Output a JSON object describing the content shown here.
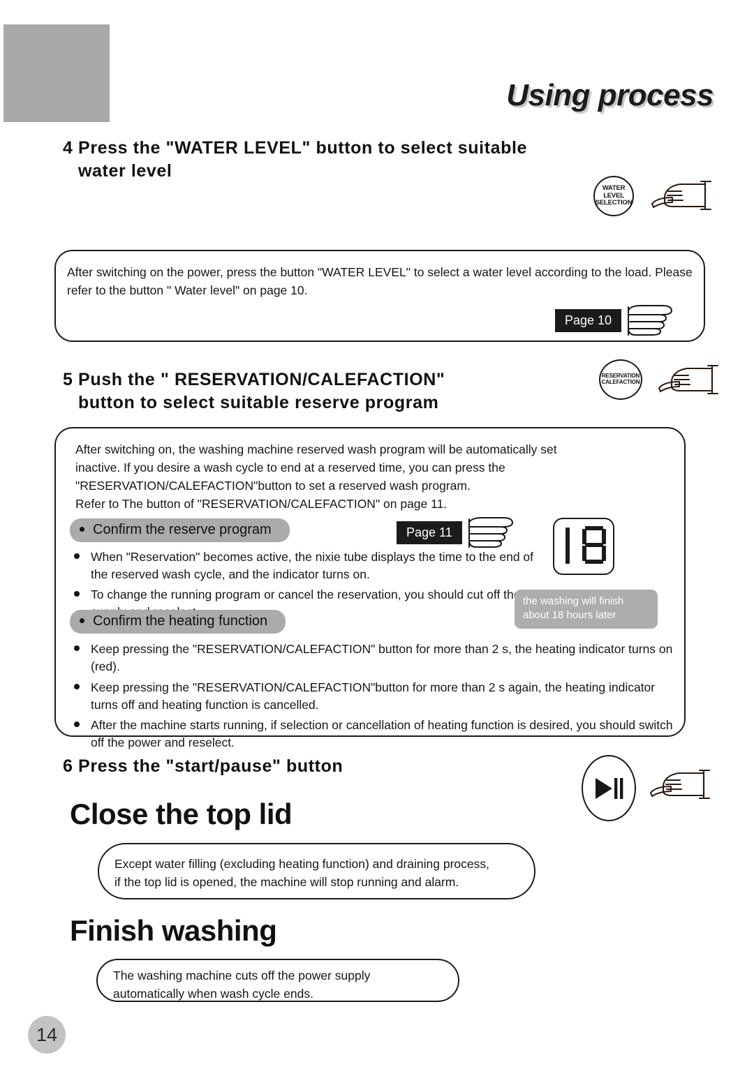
{
  "header": {
    "title": "Using process",
    "page_number": "14"
  },
  "steps": [
    {
      "number": "4",
      "line1": "4 Press the \"WATER LEVEL\" button to select suitable",
      "line2": "water level",
      "button": {
        "icon_name": "water-level-selection-button",
        "label_lines": [
          "WATER",
          "LEVEL",
          "SELECTION"
        ]
      },
      "box": {
        "paragraph": "After switching on the power, press the button \"WATER LEVEL\" to select a  water level according to the load. Please refer to the button \" Water level\" on page 10.",
        "page_ref": "Page 10"
      }
    },
    {
      "number": "5",
      "line1": "5 Push the \" RESERVATION/CALEFACTION\"",
      "line2": "button to select   suitable reserve program",
      "button": {
        "icon_name": "reservation-calefaction-button",
        "label_lines": [
          "RESERVATION",
          "CALEFACTION"
        ]
      },
      "box": {
        "paragraph_lines": [
          "After switching on, the washing machine reserved wash program will be automatically set",
          "inactive. If you desire a wash cycle to end at a reserved time, you can press the",
          "\"RESERVATION/CALEFACTION\"button to set a reserved wash program.",
          "Refer to The button of \"RESERVATION/CALEFACTION\" on page 11."
        ],
        "page_ref": "Page 11",
        "pill_reserve": "Confirm the reserve program",
        "pill_heating": "Confirm the heating function",
        "bullets_reserve": [
          "When \"Reservation\" becomes active, the nixie tube displays the time to the end of the reserved wash cycle, and the indicator turns on.",
          "To change the running program or cancel the reservation, you should cut off the supply and reselect."
        ],
        "bullets_heating": [
          "Keep pressing the \"RESERVATION/CALEFACTION\" button for more than 2 s, the heating indicator turns on (red).",
          "Keep pressing the \"RESERVATION/CALEFACTION\"button for more than 2 s again, the heating indicator turns off and heating function is cancelled.",
          "After the machine starts running, if selection or cancellation of heating function is desired, you should switch off the power and reselect."
        ],
        "nixie_value": "18",
        "tooltip_line1": "the washing will finish",
        "tooltip_line2": "about 18 hours later"
      }
    },
    {
      "number": "6",
      "line1": "6 Press the \"start/pause\" button",
      "button": {
        "icon_name": "start-pause-button"
      }
    }
  ],
  "close_lid": {
    "headline": "Close the top lid",
    "box_line1": "Except water filling (excluding heating function) and draining process,",
    "box_line2": "if the top lid is opened, the machine will stop running and alarm."
  },
  "finish_washing": {
    "headline": "Finish washing",
    "box_line1": "The washing machine cuts off the power supply",
    "box_line2": "automatically when wash cycle ends."
  },
  "colors": {
    "gray_block": "#a8a8a8",
    "gray_pill": "#ababab",
    "tooltip_bg": "#adadad",
    "ink": "#1b1b1b",
    "page_badge": "#c3c3c3"
  }
}
